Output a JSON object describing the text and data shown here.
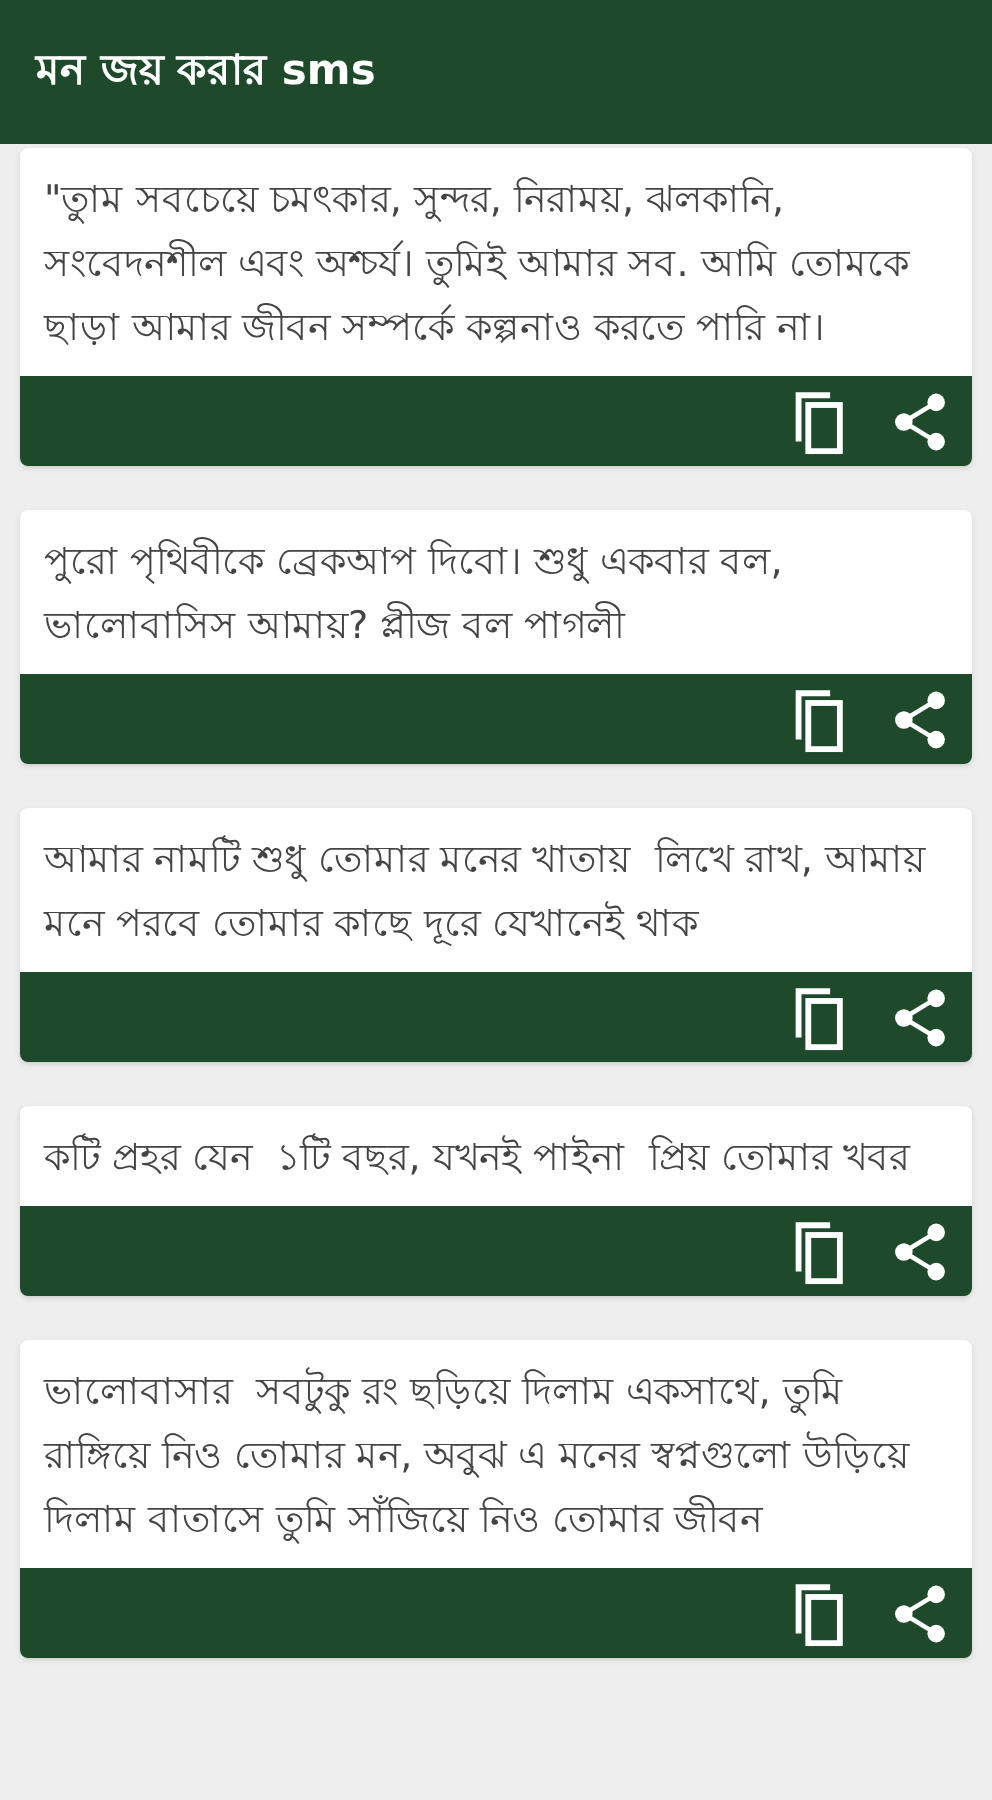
{
  "app_bar": {
    "title": "মন জয় করার sms"
  },
  "messages": [
    {
      "text": "\"তুাম সবচেয়ে চমৎকার, সুন্দর, নিরাময়, ঝলকানি, সংবেদনশীল এবং অশ্চর্য। তুমিই আমার সব. আমি তোমকে ছাড়া আমার জীবন সম্পর্কে কল্পনাও করতে পারি না।"
    },
    {
      "text": "পুরো পৃথিবীকে ব্রেকআপ দিবো। শুধু একবার বল, ভালোবাসিস আমায়? প্লীজ বল পাগলী"
    },
    {
      "text": "আমার নামটি শুধু তোমার মনের খাতায়  লিখে রাখ, আমায় মনে পরবে তোমার কাছে দূরে যেখানেই থাক"
    },
    {
      "text": "কটি প্রহর যেন  ১টি বছর, যখনই পাইনা  প্রিয় তোমার খবর"
    },
    {
      "text": "ভালোবাসার  সবটুকু রং ছড়িয়ে দিলাম একসাথে, তুমি রাঙ্গিয়ে নিও তোমার মন, অবুঝ এ মনের স্বপ্নগুলো উড়িয়ে দিলাম বাতাসে তুমি সাঁজিয়ে নিও তোমার জীবন"
    }
  ]
}
